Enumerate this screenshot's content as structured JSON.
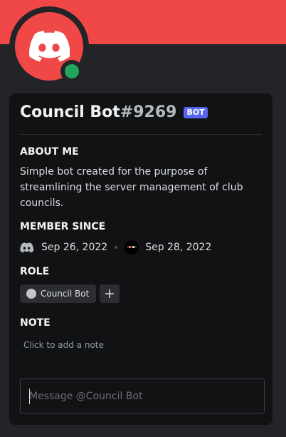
{
  "colors": {
    "banner": "#f04747",
    "avatar_bg": "#f04747",
    "status_online": "#23a55a",
    "bot_tag": "#5865f2",
    "role_dot": "#c4c4c4"
  },
  "profile": {
    "username": "Council Bot",
    "discriminator": "#9269",
    "bot_tag": "BOT",
    "avatar_icon": "discord-logo-icon",
    "status": "online"
  },
  "about_me": {
    "title": "ABOUT ME",
    "text": "Simple bot created for the purpose of streamlining the server management of club councils."
  },
  "member_since": {
    "title": "MEMBER SINCE",
    "discord_date": "Sep 26, 2022",
    "discord_icon": "discord-logo-icon",
    "server_date": "Sep 28, 2022",
    "server_icon": "server-icon"
  },
  "role": {
    "title": "ROLE",
    "roles": [
      {
        "name": "Council Bot"
      }
    ],
    "add_icon": "plus-icon"
  },
  "note": {
    "title": "NOTE",
    "placeholder": "Click to add a note"
  },
  "message": {
    "placeholder": "Message @Council Bot"
  }
}
